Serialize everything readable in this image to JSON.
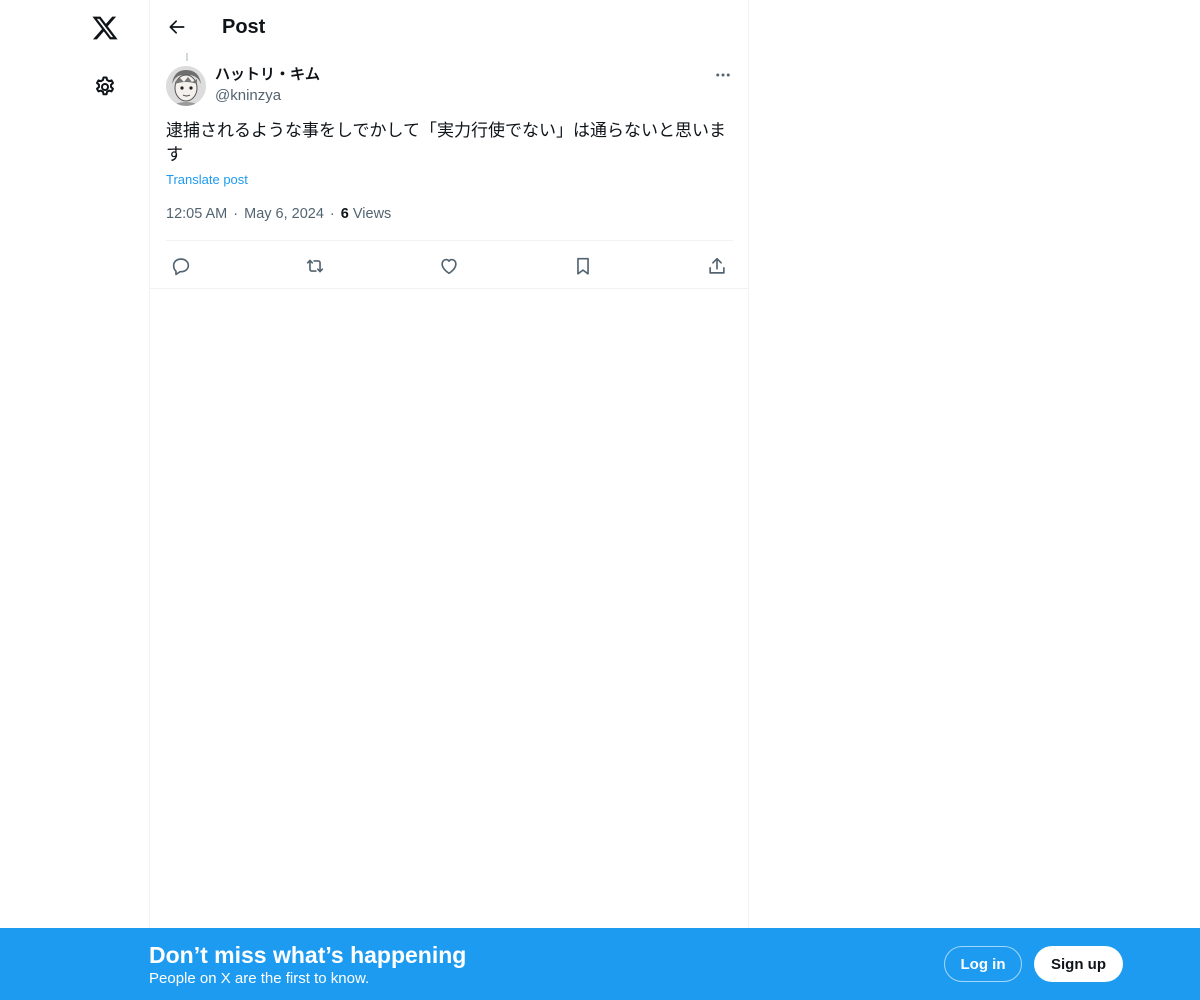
{
  "nav": {
    "logo_icon": "x-logo-icon",
    "settings_icon": "gear-icon"
  },
  "header": {
    "title": "Post",
    "back_icon": "arrow-left-icon"
  },
  "tweet": {
    "author": {
      "name": "ハットリ・キム",
      "handle": "@kninzya"
    },
    "text": "逮捕されるような事をしでかして「実力行使でない」は通らないと思います",
    "translate_label": "Translate post",
    "time": "12:05 AM",
    "date": "May 6, 2024",
    "views_count": "6",
    "views_label": "Views",
    "separator": "·"
  },
  "actions": {
    "reply_icon": "reply-icon",
    "retweet_icon": "repost-icon",
    "like_icon": "heart-icon",
    "bookmark_icon": "bookmark-icon",
    "share_icon": "share-icon"
  },
  "banner": {
    "title": "Don’t miss what’s happening",
    "subtitle": "People on X are the first to know.",
    "login_label": "Log in",
    "signup_label": "Sign up",
    "color": "#1d9bf0"
  }
}
